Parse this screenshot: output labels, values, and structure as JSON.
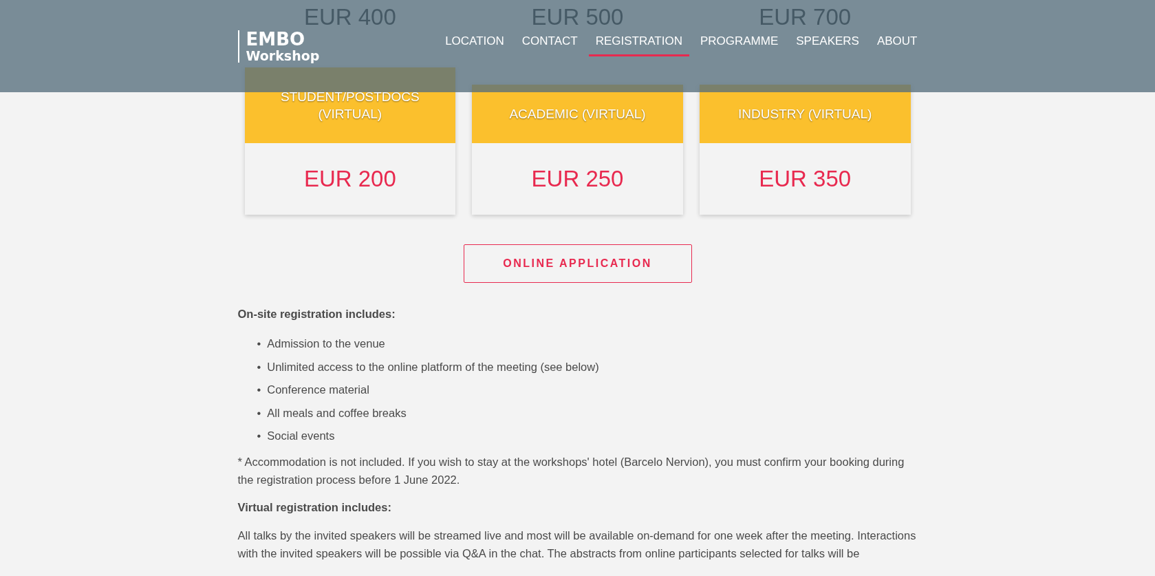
{
  "header": {
    "logo_title": "EMBO",
    "logo_subtitle": "Workshop",
    "nav": [
      {
        "label": "LOCATION",
        "selected": false
      },
      {
        "label": "CONTACT",
        "selected": false
      },
      {
        "label": "REGISTRATION",
        "selected": true
      },
      {
        "label": "PROGRAMME",
        "selected": false
      },
      {
        "label": "SPEAKERS",
        "selected": false
      },
      {
        "label": "ABOUT",
        "selected": false
      }
    ]
  },
  "onsite_prices": [
    "EUR 400",
    "EUR 500",
    "EUR 700"
  ],
  "virtual_fees": [
    {
      "category": "STUDENT/POSTDOCS (VIRTUAL)",
      "price": "EUR 200"
    },
    {
      "category": "ACADEMIC (VIRTUAL)",
      "price": "EUR 250"
    },
    {
      "category": "INDUSTRY (VIRTUAL)",
      "price": "EUR 350"
    }
  ],
  "apply_button": "ONLINE APPLICATION",
  "onsite_heading": "On-site registration includes:",
  "onsite_items": [
    {
      "marker": "•",
      "text": "Admission to the venue"
    },
    {
      "marker": "•",
      "text": "Unlimited access to the online platform of the meeting (see below)"
    },
    {
      "marker": "•",
      "text": "Conference material"
    },
    {
      "marker": "•",
      "text": "All meals and coffee breaks"
    },
    {
      "marker": "•",
      "text": "Social events"
    }
  ],
  "accommodation_note": "* Accommodation is not included. If you wish to stay at the workshops' hotel (Barcelo Nervion), you must confirm your booking during the registration process before 1 June 2022.",
  "virtual_heading": "Virtual registration includes:",
  "virtual_text": "All talks by the invited speakers will be streamed live and most will be available on-demand for one week after the meeting. Interactions with the invited speakers will be possible via Q&A in the chat. The abstracts from online participants selected for talks will be"
}
